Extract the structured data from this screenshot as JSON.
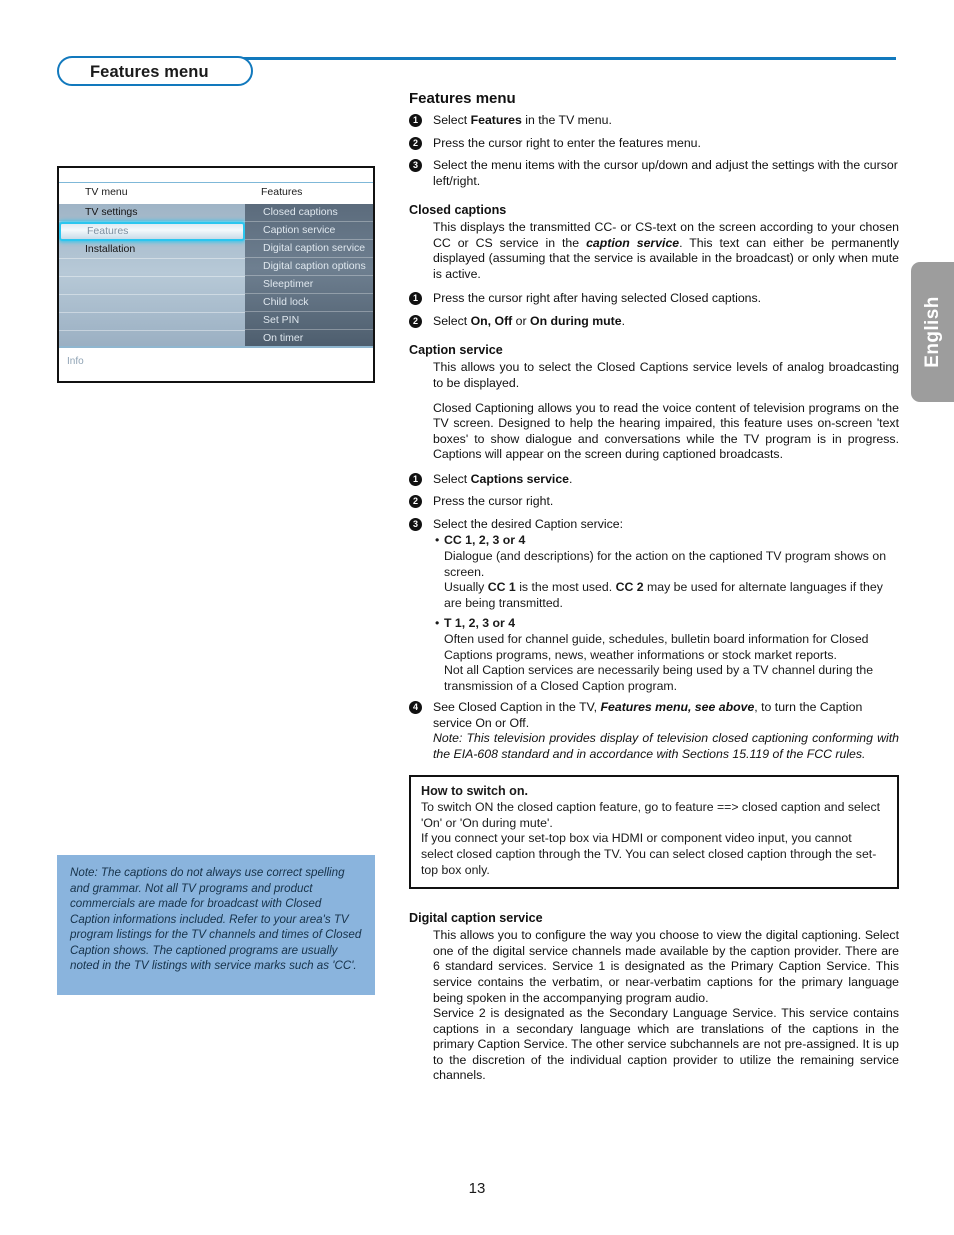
{
  "header": {
    "pill_title": "Features menu"
  },
  "language_tab": {
    "label": "English"
  },
  "tv_menu_screenshot": {
    "left_header": "TV menu",
    "right_header": "Features",
    "left_items": [
      {
        "label": "TV settings",
        "selected": false
      },
      {
        "label": "Features",
        "selected": true
      },
      {
        "label": "Installation",
        "selected": false
      },
      {
        "label": "",
        "selected": false
      },
      {
        "label": "",
        "selected": false
      },
      {
        "label": "",
        "selected": false
      },
      {
        "label": "",
        "selected": false
      },
      {
        "label": "",
        "selected": false
      }
    ],
    "right_items": [
      {
        "label": "Closed captions"
      },
      {
        "label": "Caption service"
      },
      {
        "label": "Digital caption service"
      },
      {
        "label": "Digital caption options"
      },
      {
        "label": "Sleeptimer"
      },
      {
        "label": "Child lock"
      },
      {
        "label": "Set PIN"
      },
      {
        "label": "On timer"
      }
    ],
    "footer_label": "Info"
  },
  "note_box": {
    "text": "Note: The captions do not always use correct spelling and grammar. Not all TV programs and product commercials are made for broadcast with Closed Caption informations included. Refer to your area's TV program listings for the TV channels and times of Closed Caption shows. The captioned programs are usually noted in the TV listings with service marks such as 'CC'."
  },
  "main": {
    "section_title": "Features menu",
    "steps_intro": [
      {
        "num": "1",
        "html": "Select <b>Features</b> in the TV menu."
      },
      {
        "num": "2",
        "html": "Press the cursor right to enter the features menu."
      },
      {
        "num": "3",
        "html": "Select the menu items with the cursor up/down and adjust the settings with the cursor left/right."
      }
    ],
    "closed_captions": {
      "title": "Closed captions",
      "body_html": "This displays the transmitted CC- or CS-text on the screen according to your chosen CC or CS service in the <i class=\"bi\">caption service</i>. This text can either be permanently displayed (assuming that the service is available in the broadcast) or only when mute is active.",
      "steps": [
        {
          "num": "1",
          "html": "Press the cursor right after having selected Closed captions."
        },
        {
          "num": "2",
          "html": "Select <b>On, Off</b> or <b>On during mute</b>."
        }
      ]
    },
    "caption_service": {
      "title": "Caption service",
      "para1": "This allows you to select the Closed Captions service levels of analog broadcasting to be displayed.",
      "para2": "Closed Captioning allows you to read the voice content of television programs on the TV screen. Designed to help the hearing impaired, this feature uses on-screen 'text boxes' to show dialogue and conversations while the TV program is in progress. Captions will appear on the screen during captioned broadcasts.",
      "steps": [
        {
          "num": "1",
          "html": "Select <b>Captions service</b>."
        },
        {
          "num": "2",
          "html": "Press the cursor right."
        },
        {
          "num": "3",
          "html": "Select the desired Caption service:"
        }
      ],
      "cc_bullet_label": "CC 1, 2, 3 or 4",
      "cc_bullet_body": "Dialogue (and descriptions) for the action on the captioned TV program shows on screen.",
      "cc_bullet_body2_html": "Usually <b>CC 1</b> is the most used. <b>CC 2</b> may be used for alternate languages if they are being transmitted.",
      "t_bullet_label": "T 1, 2, 3 or 4",
      "t_bullet_body": "Often used for channel guide, schedules, bulletin board information for Closed Captions programs, news, weather informations or stock market reports.",
      "t_bullet_body2": "Not all Caption services are necessarily being used by a TV channel during the transmission of a Closed Caption program.",
      "step4_html": "See Closed Caption in the TV, <i class=\"bi\">Features menu, see above</i>, to turn the Caption service On or Off.",
      "step4_num": "4",
      "step4_note": "Note: This television provides display of television closed captioning conforming with the EIA-608 standard and in accordance with Sections 15.119 of the FCC rules."
    },
    "switch_box": {
      "heading": "How to switch on.",
      "para1": "To switch ON the closed caption feature, go to feature ==> closed caption and select 'On' or 'On during mute'.",
      "para2": "If you connect your set-top box via HDMI or component video input, you cannot select closed caption through the TV. You can select closed caption through the set-top box only."
    },
    "digital_caption_service": {
      "title": "Digital caption service",
      "body": "This allows you to configure the way you choose to view the digital captioning. Select one of the digital service channels made available by the caption provider. There are 6 standard services. Service 1 is designated as the Primary Caption Service. This service contains the verbatim, or near-verbatim captions for the primary language being spoken in the accompanying program audio.",
      "body2": "Service 2 is designated as the Secondary Language Service. This service contains captions in a secondary language which are translations of the captions in the primary Caption Service. The other service subchannels are not pre-assigned. It is up to the discretion of the individual caption provider to utilize the remaining service channels."
    }
  },
  "footer": {
    "page_number": "13"
  }
}
